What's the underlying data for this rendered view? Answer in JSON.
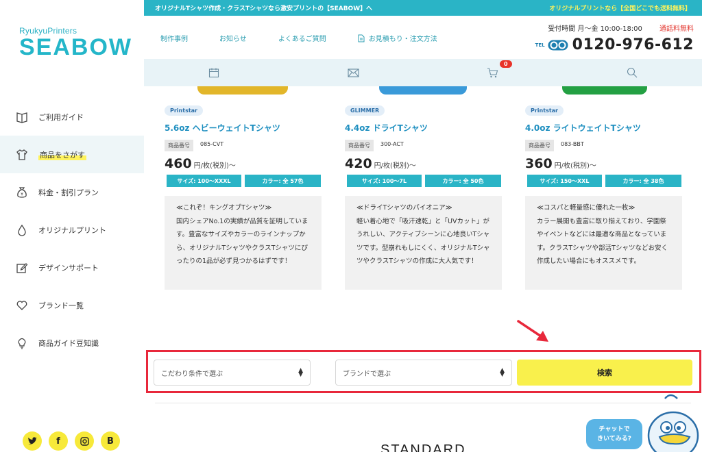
{
  "brand": {
    "small": "RyukyuPrinters",
    "big": "SEABOW"
  },
  "topbar": {
    "left": "オリジナルTシャツ作成・クラスTシャツなら激安プリントの【SEABOW】へ",
    "right": "オリジナルプリントなら【全国どこでも送料無料】"
  },
  "header": {
    "menu": [
      "制作事例",
      "お知らせ",
      "よくあるご質問",
      "お見積もり・注文方法"
    ],
    "hours": "受付時間 月～金 10:00-18:00",
    "free_call": "通話料無料",
    "tel_label": "TEL",
    "phone": "0120-976-612"
  },
  "iconbar": {
    "cart_count": "0"
  },
  "sidebar": {
    "items": [
      {
        "label": "ご利用ガイド",
        "icon": "book-icon"
      },
      {
        "label": "商品をさがす",
        "icon": "tshirt-icon",
        "active": true
      },
      {
        "label": "料金・割引プラン",
        "icon": "money-bag-icon"
      },
      {
        "label": "オリジナルプリント",
        "icon": "drop-icon"
      },
      {
        "label": "デザインサポート",
        "icon": "edit-icon"
      },
      {
        "label": "ブランド一覧",
        "icon": "heart-icon"
      },
      {
        "label": "商品ガイド豆知識",
        "icon": "bulb-icon"
      }
    ],
    "social": [
      "twitter-icon",
      "facebook-icon",
      "instagram-icon",
      "blog-icon"
    ]
  },
  "products": [
    {
      "brand": "Printstar",
      "name": "5.6oz ヘビーウェイトTシャツ",
      "code_label": "商品番号",
      "code": "085-CVT",
      "price": "460",
      "unit": "円/枚(税別)～",
      "size": "サイズ: 100〜XXXL",
      "color": "カラー: 全 57色",
      "image_color": "#e2b62a",
      "desc": "≪これぞ！キングオブTシャツ≫\n国内シェアNo.1の実績が品質を証明しています。豊富なサイズやカラーのラインナップから、オリジナルTシャツやクラスTシャツにぴったりの1品が必ず見つかるはずです！"
    },
    {
      "brand": "GLIMMER",
      "name": "4.4oz ドライTシャツ",
      "code_label": "商品番号",
      "code": "300-ACT",
      "price": "420",
      "unit": "円/枚(税別)～",
      "size": "サイズ: 100〜7L",
      "color": "カラー: 全 50色",
      "image_color": "#3a9ad9",
      "desc": "≪ドライTシャツのパイオニア≫\n軽い着心地で「吸汗速乾」と「UVカット」がうれしい、アクティブシーンに心地良いTシャツです。型崩れもしにくく、オリジナルTシャツやクラスTシャツの作成に大人気です！"
    },
    {
      "brand": "Printstar",
      "name": "4.0oz ライトウェイトTシャツ",
      "code_label": "商品番号",
      "code": "083-BBT",
      "price": "360",
      "unit": "円/枚(税別)～",
      "size": "サイズ: 150〜XXL",
      "color": "カラー: 全 38色",
      "image_color": "#23a043",
      "desc": "≪コスパと軽量感に優れた一枚≫\nカラー展開も豊富に取り揃えており、学園祭やイベントなどには最適な商品となっています。クラスTシャツや部活Tシャツなどお安く作成したい場合にもオススメです。"
    }
  ],
  "search": {
    "condition": "こだわり条件で選ぶ",
    "brand": "ブランドで選ぶ",
    "button": "検索"
  },
  "section_heading": "STANDARD",
  "chat": {
    "line1": "チャットで",
    "line2": "きいてみる?"
  },
  "colors": {
    "accent": "#2ab4c6",
    "highlight": "#f9f04c",
    "alert": "#e8283b"
  }
}
